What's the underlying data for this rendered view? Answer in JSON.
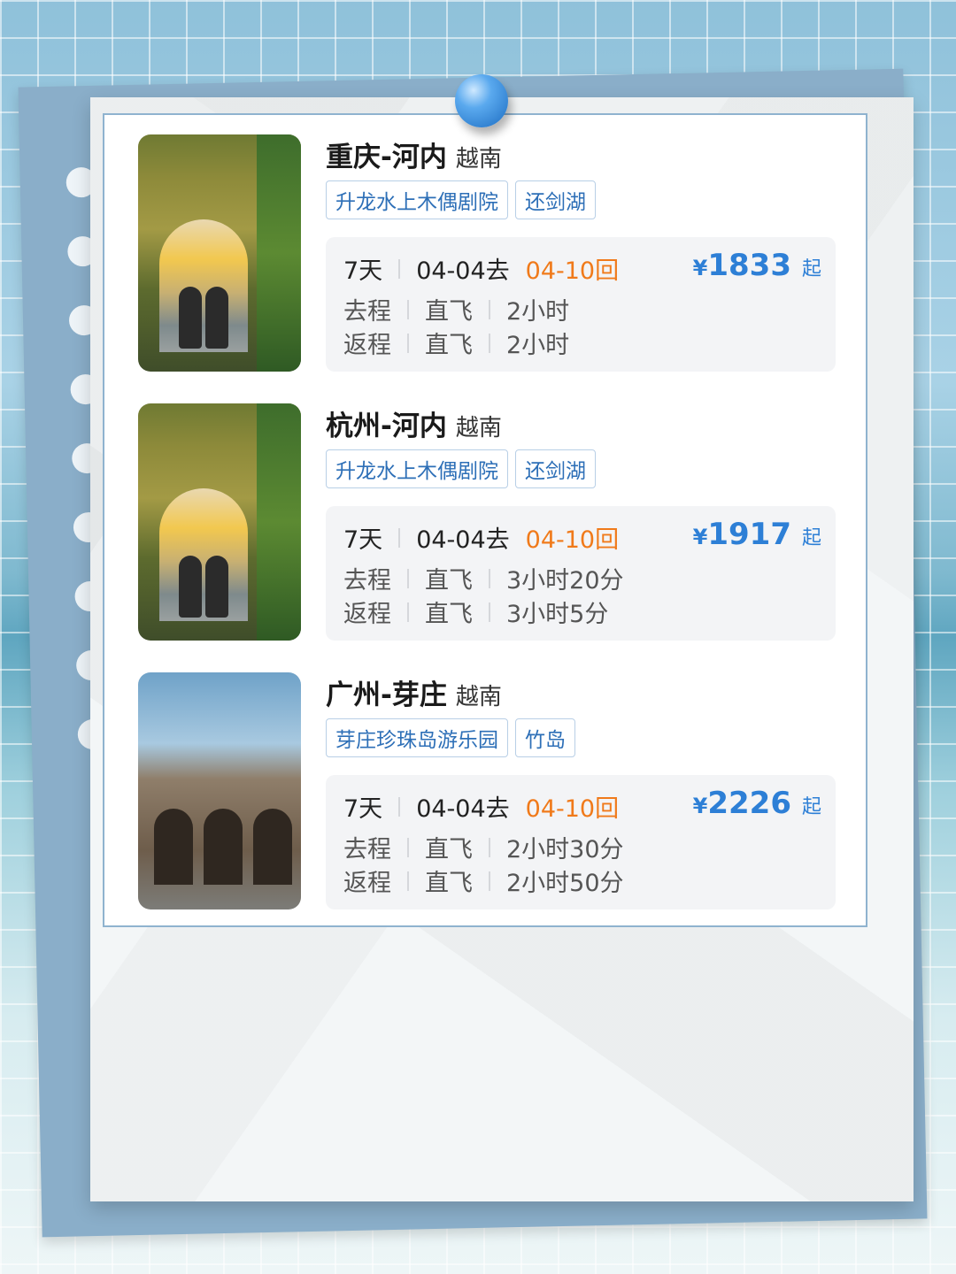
{
  "trips": [
    {
      "route": "重庆-河内",
      "country": "越南",
      "tags": [
        "升龙水上木偶剧院",
        "还剑湖"
      ],
      "days": "7天",
      "depart": "04-04去",
      "return": "04-10回",
      "price_symbol": "¥",
      "price": "1833",
      "price_suffix": "起",
      "outbound": {
        "label": "去程",
        "type": "直飞",
        "duration": "2小时"
      },
      "inbound": {
        "label": "返程",
        "type": "直飞",
        "duration": "2小时"
      },
      "image": "hanoi-gate-photo"
    },
    {
      "route": "杭州-河内",
      "country": "越南",
      "tags": [
        "升龙水上木偶剧院",
        "还剑湖"
      ],
      "days": "7天",
      "depart": "04-04去",
      "return": "04-10回",
      "price_symbol": "¥",
      "price": "1917",
      "price_suffix": "起",
      "outbound": {
        "label": "去程",
        "type": "直飞",
        "duration": "3小时20分"
      },
      "inbound": {
        "label": "返程",
        "type": "直飞",
        "duration": "3小时5分"
      },
      "image": "hanoi-gate-photo"
    },
    {
      "route": "广州-芽庄",
      "country": "越南",
      "tags": [
        "芽庄珍珠岛游乐园",
        "竹岛"
      ],
      "days": "7天",
      "depart": "04-04去",
      "return": "04-10回",
      "price_symbol": "¥",
      "price": "2226",
      "price_suffix": "起",
      "outbound": {
        "label": "去程",
        "type": "直飞",
        "duration": "2小时30分"
      },
      "inbound": {
        "label": "返程",
        "type": "直飞",
        "duration": "2小时50分"
      },
      "image": "nha-trang-cathedral-photo"
    }
  ],
  "colors": {
    "accent": "#2d7fd6",
    "return_date": "#f07a1a",
    "tag_text": "#2d6fb7",
    "card_border": "#8fb3cf"
  }
}
